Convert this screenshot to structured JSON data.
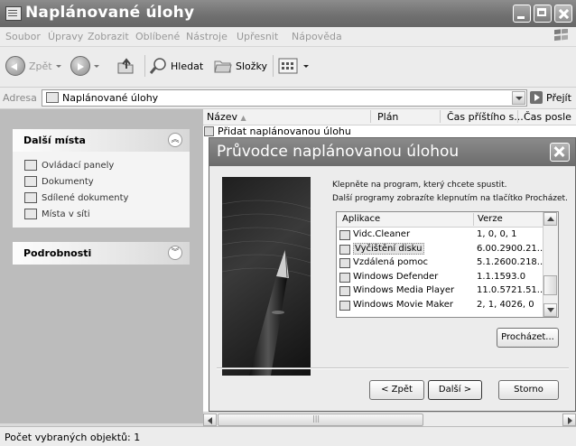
{
  "window": {
    "title": "Naplánované úlohy"
  },
  "menu": [
    "Soubor",
    "Úpravy",
    "Zobrazit",
    "Oblíbené",
    "Nástroje",
    "Upřesnit",
    "Nápověda"
  ],
  "toolbar": {
    "back_label": "Zpět",
    "search_label": "Hledat",
    "folders_label": "Složky"
  },
  "address": {
    "label": "Adresa",
    "value": "Naplánované úlohy",
    "go_label": "Přejít"
  },
  "left_panel": {
    "other_places": {
      "title": "Další místa",
      "items": [
        "Ovládací panely",
        "Dokumenty",
        "Sdílené dokumenty",
        "Místa v síti"
      ]
    },
    "details": {
      "title": "Podrobnosti"
    }
  },
  "list": {
    "columns": [
      "Název",
      "Plán",
      "Čas příštího s...",
      "Čas posle"
    ],
    "rows": [
      "Přidat naplánovanou úlohu"
    ]
  },
  "dialog": {
    "title": "Průvodce naplánovanou úlohou",
    "instruction": "Klepněte na program, který chcete spustit.",
    "hint": "Další programy zobrazíte klepnutím na tlačítko Procházet.",
    "columns": [
      "Aplikace",
      "Verze"
    ],
    "apps": [
      {
        "name": "Vidc.Cleaner",
        "version": "1, 0, 0, 1",
        "icon": "vidc-icon"
      },
      {
        "name": "Vyčištění disku",
        "version": "6.00.2900.21...",
        "icon": "disk-cleanup-icon",
        "selected": true
      },
      {
        "name": "Vzdálená pomoc",
        "version": "5.1.2600.218...",
        "icon": "remote-assistance-icon"
      },
      {
        "name": "Windows Defender",
        "version": "1.1.1593.0",
        "icon": "defender-icon"
      },
      {
        "name": "Windows Media Player",
        "version": "11.0.5721.51...",
        "icon": "media-player-icon"
      },
      {
        "name": "Windows Movie Maker",
        "version": "2, 1, 4026, 0",
        "icon": "movie-maker-icon"
      }
    ],
    "browse_label": "Procházet...",
    "back_label": "< Zpět",
    "next_label": "Další >",
    "cancel_label": "Storno"
  },
  "status": {
    "text": "Počet vybraných objektů: 1"
  }
}
